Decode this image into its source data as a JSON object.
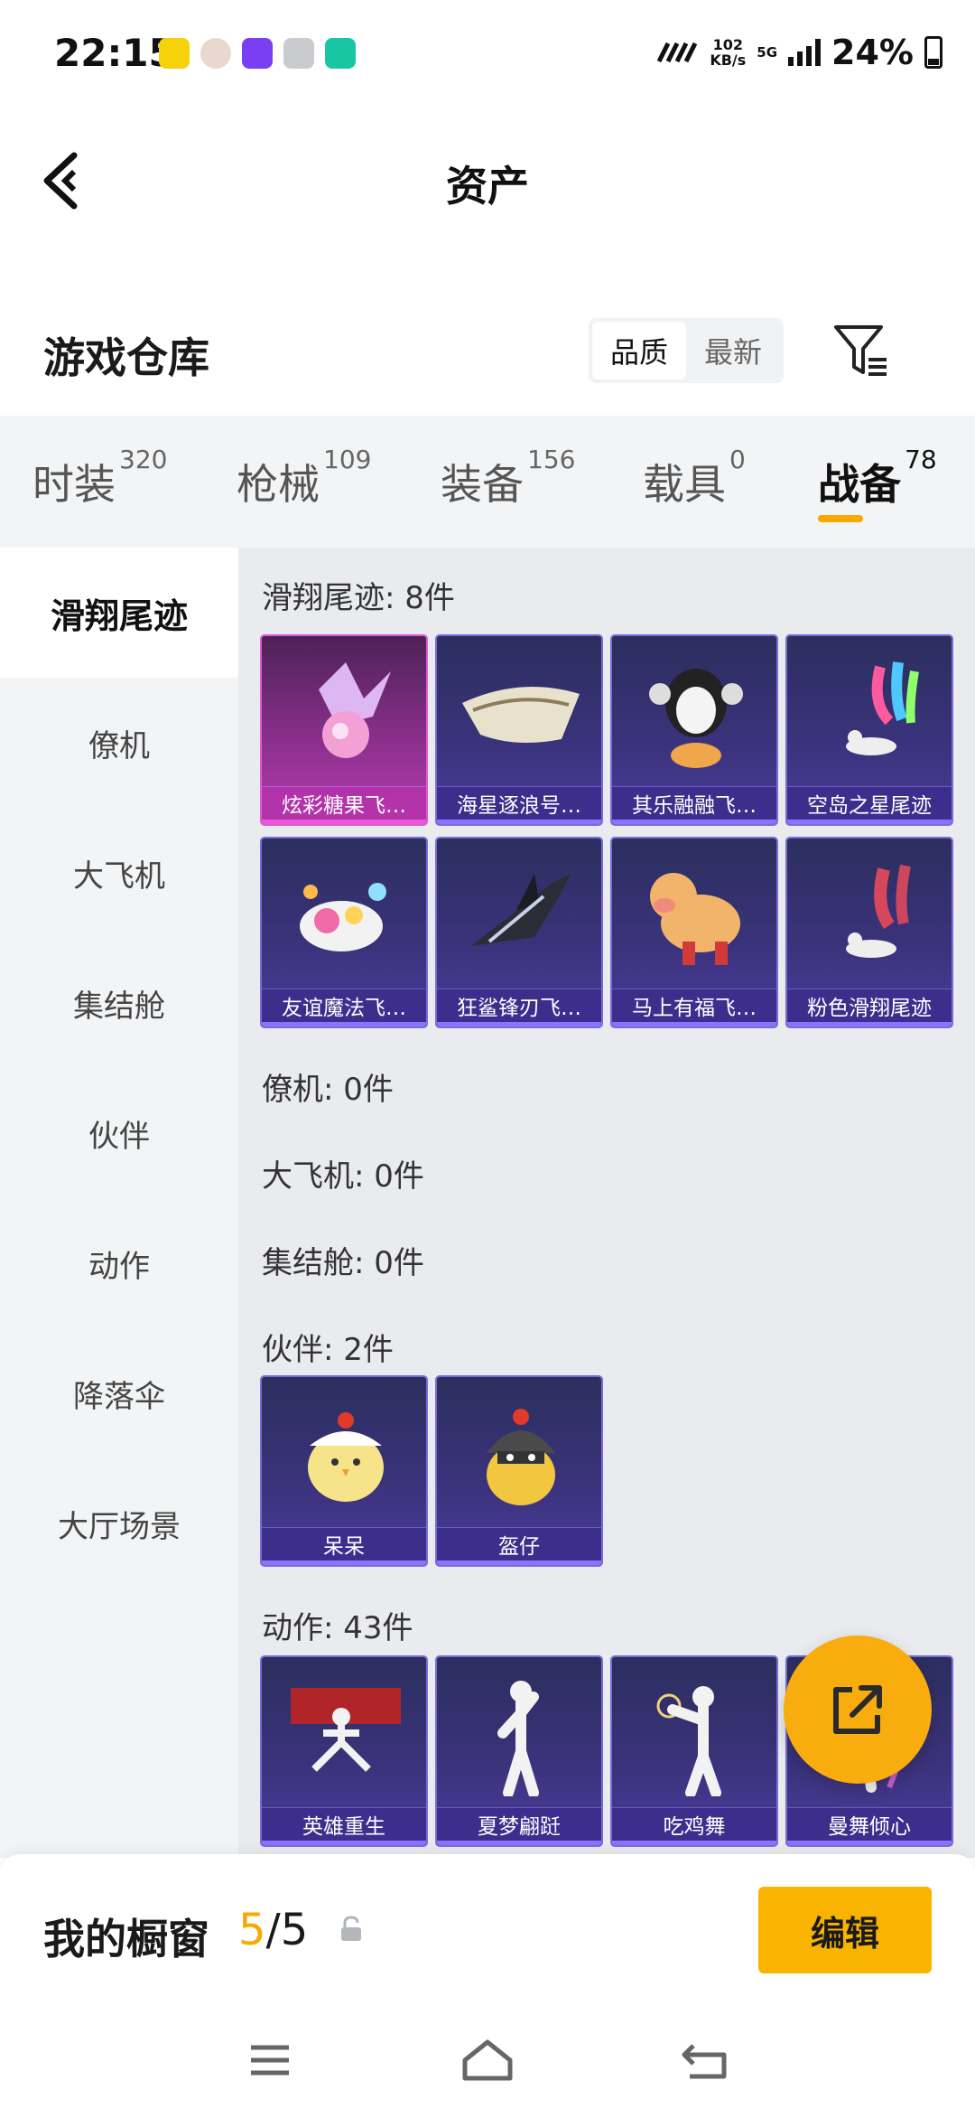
{
  "status_bar": {
    "time": "22:15",
    "net_speed_value": "102",
    "net_speed_unit": "KB/s",
    "network": "5G",
    "battery": "24%",
    "app_icons": [
      "app-icon-yellow",
      "avatar-icon",
      "purple-app-icon",
      "gear-app-icon",
      "green-app-icon"
    ]
  },
  "header": {
    "title": "资产",
    "back_icon": "chevron-left-icon"
  },
  "section": {
    "title": "游戏仓库",
    "sort_options": [
      "品质",
      "最新"
    ],
    "active_sort": "品质",
    "filter_icon": "filter-icon"
  },
  "tabs": [
    {
      "label": "时装",
      "count": "320"
    },
    {
      "label": "枪械",
      "count": "109"
    },
    {
      "label": "装备",
      "count": "156"
    },
    {
      "label": "载具",
      "count": "0"
    },
    {
      "label": "战备",
      "count": "78"
    }
  ],
  "active_tab": "战备",
  "sidebar": {
    "items": [
      "滑翔尾迹",
      "僚机",
      "大飞机",
      "集结舱",
      "伙伴",
      "动作",
      "降落伞",
      "大厅场景"
    ],
    "active": "滑翔尾迹"
  },
  "groups": [
    {
      "title": "滑翔尾迹: 8件",
      "items": [
        "炫彩糖果飞…",
        "海星逐浪号…",
        "其乐融融飞…",
        "空岛之星尾迹",
        "友谊魔法飞…",
        "狂鲨锋刃飞…",
        "马上有福飞…",
        "粉色滑翔尾迹"
      ]
    },
    {
      "title": "僚机: 0件",
      "items": []
    },
    {
      "title": "大飞机: 0件",
      "items": []
    },
    {
      "title": "集结舱: 0件",
      "items": []
    },
    {
      "title": "伙伴: 2件",
      "items": [
        "呆呆",
        "盔仔"
      ]
    },
    {
      "title": "动作: 43件",
      "items": [
        "英雄重生",
        "夏梦翩跹",
        "吃鸡舞",
        "曼舞倾心"
      ]
    }
  ],
  "fab": {
    "icon": "share-external-icon"
  },
  "showcase": {
    "label": "我的橱窗",
    "current": "5",
    "separator": "/",
    "total": "5",
    "lock_icon": "lock-icon",
    "edit_label": "编辑"
  },
  "navbar": {
    "icons": [
      "menu-icon",
      "home-icon",
      "back-icon"
    ]
  },
  "colors": {
    "accent": "#f8b400",
    "card_purple": "#3a327a",
    "card_pink": "#8a2f8c"
  }
}
